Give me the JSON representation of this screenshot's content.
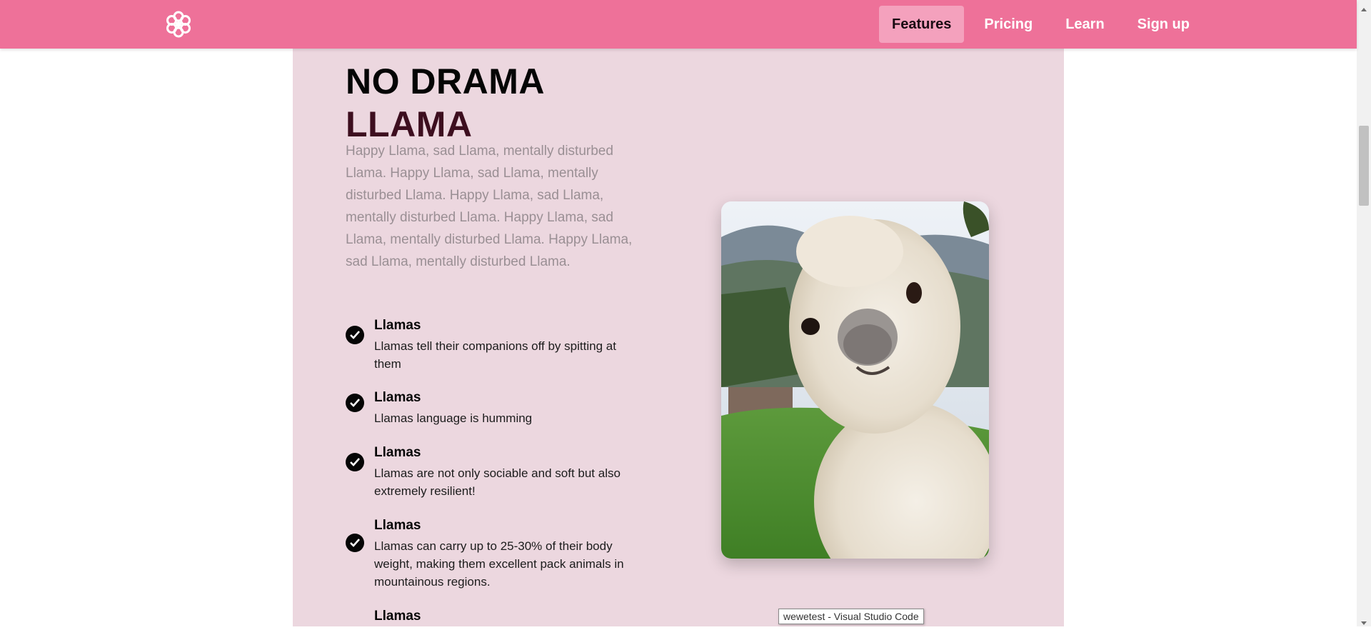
{
  "nav": {
    "logo_icon": "flower-logo-icon",
    "links": [
      "Features",
      "Pricing",
      "Learn",
      "Sign up"
    ],
    "active": "Features"
  },
  "hero": {
    "title_line1": "NO DRAMA",
    "title_line2": "LLAMA",
    "intro": "Happy Llama, sad Llama, mentally disturbed Llama. Happy Llama, sad Llama, mentally disturbed Llama. Happy Llama, sad Llama, mentally disturbed Llama. Happy Llama, sad Llama, mentally disturbed Llama. Happy Llama, sad Llama, mentally disturbed Llama."
  },
  "features": [
    {
      "title": "Llamas",
      "desc": "Llamas tell their companions off by spitting at them"
    },
    {
      "title": "Llamas",
      "desc": "Llamas language is humming"
    },
    {
      "title": "Llamas",
      "desc": "Llamas are not only sociable and soft but also extremely resilient!"
    },
    {
      "title": "Llamas",
      "desc": "Llamas can carry up to 25-30% of their body weight, making them excellent pack animals in mountainous regions."
    },
    {
      "title": "Llamas",
      "desc": ""
    }
  ],
  "tooltip": "wewetest - Visual Studio Code",
  "colors": {
    "navbar": "#ee7199",
    "panel": "#ecd7df",
    "active_tab": "#f4a1bd",
    "title_accent": "#3d0e1f"
  }
}
